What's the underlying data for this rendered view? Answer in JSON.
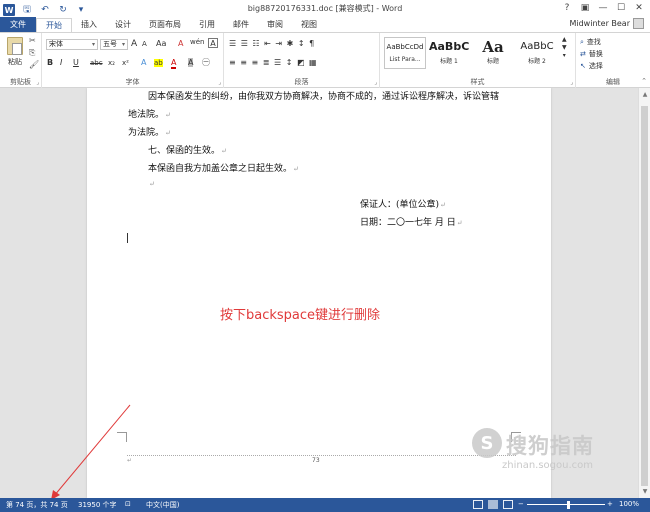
{
  "window": {
    "title": "big88720176331.doc [兼容模式] - Word",
    "logo": "W",
    "save_glyph": "🖫",
    "undo_glyph": "↶",
    "redo_glyph": "↻",
    "qat_more": "▾",
    "help": "?",
    "ribbon_options": "▣",
    "minimize": "—",
    "maximize": "☐",
    "close": "✕",
    "user": "Midwinter Bear"
  },
  "tabs": [
    "文件",
    "开始",
    "插入",
    "设计",
    "页面布局",
    "引用",
    "邮件",
    "审阅",
    "视图"
  ],
  "ribbon": {
    "clipboard": {
      "label": "剪贴板",
      "paste": "粘贴",
      "cut": "✂",
      "copy": "⎘",
      "format_painter": "🖌"
    },
    "font": {
      "label": "字体",
      "font_name": "宋体",
      "font_size": "五号",
      "grow": "A",
      "shrink": "A",
      "case": "Aa",
      "clear": "A",
      "phonetic": "wén",
      "border": "A",
      "bold": "B",
      "italic": "I",
      "underline": "U",
      "strike": "abc",
      "subscript": "x₂",
      "superscript": "x²",
      "effects": "A",
      "highlight": "ab",
      "color": "A",
      "shade": "A",
      "encircle": "㊀"
    },
    "paragraph": {
      "label": "段落",
      "row1": "☰  ☰  ☷  ⇤  ⇥  ✱  ↕  ¶",
      "row2": "≡  ≡  ≡  ≣  ☰  ↕  ◩  ▦"
    },
    "styles": {
      "label": "样式",
      "tiles": [
        {
          "preview": "AaBbCcDd",
          "name": "List Para..."
        },
        {
          "preview": "AaBbC",
          "name": "标题 1"
        },
        {
          "preview": "Aa",
          "name": "标题"
        },
        {
          "preview": "AaBbC",
          "name": "标题 2"
        }
      ]
    },
    "editing": {
      "label": "编辑",
      "find": "查找",
      "replace": "替换",
      "select": "选择"
    }
  },
  "document": {
    "lines": [
      "因本保函发生的纠纷，由你我双方协商解决，协商不成的，通过诉讼程序解决，诉讼管辖",
      "地法院。",
      "为法院。",
      "七、保函的生效。",
      "本保函自我方加盖公章之日起生效。",
      "",
      "保证人：(单位公章)",
      "日期：二〇一七年     月     日"
    ],
    "para_mark": "↵",
    "page_number": "73",
    "annotation": "按下backspace键进行删除"
  },
  "watermark": {
    "logo": "S",
    "cn": "搜狗指南",
    "en": "zhinan.sogou.com"
  },
  "status": {
    "page": "第 74 页，共 74 页",
    "words": "31950 个字",
    "language": "中文(中国)",
    "zoom_minus": "−",
    "zoom_plus": "+",
    "zoom": "100%"
  },
  "colors": {
    "brand": "#2b579a",
    "annotation": "#e03a3a"
  }
}
